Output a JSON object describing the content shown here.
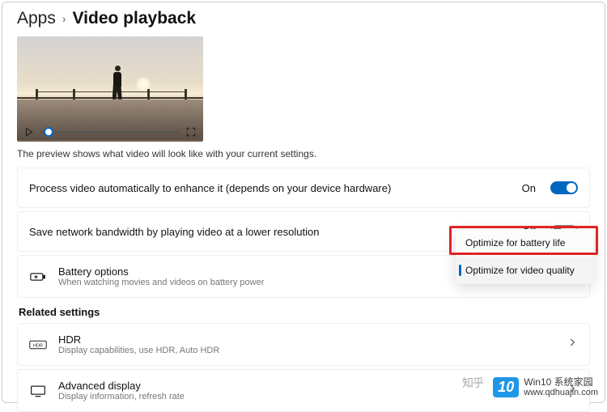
{
  "breadcrumb": {
    "parent": "Apps",
    "current": "Video playback"
  },
  "preview_caption": "The preview shows what video will look like with your current settings.",
  "settings": {
    "process_video": {
      "label": "Process video automatically to enhance it (depends on your device hardware)",
      "state_text": "On",
      "on": true
    },
    "save_bandwidth": {
      "label": "Save network bandwidth by playing video at a lower resolution",
      "state_text": "Off",
      "on": false
    },
    "battery": {
      "title": "Battery options",
      "sub": "When watching movies and videos on battery power",
      "options": [
        "Optimize for battery life",
        "Optimize for video quality"
      ],
      "selected_index": 1
    }
  },
  "related_heading": "Related settings",
  "related": {
    "hdr": {
      "title": "HDR",
      "sub": "Display capabilities, use HDR, Auto HDR"
    },
    "advanced": {
      "title": "Advanced display",
      "sub": "Display information, refresh rate"
    }
  },
  "watermark": {
    "badge": "10",
    "line1": "Win10 系统家园",
    "line2": "www.qdhuajin.com"
  },
  "zhihu": "知乎"
}
